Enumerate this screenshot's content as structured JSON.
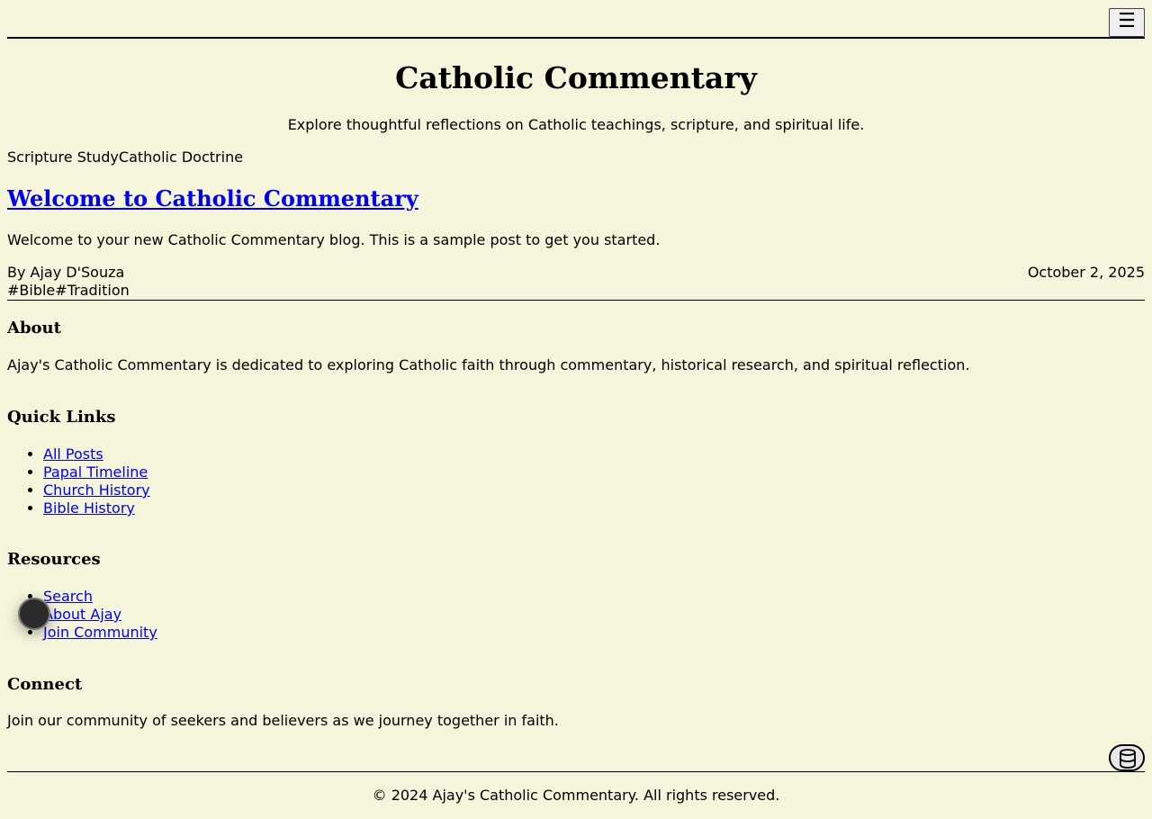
{
  "header": {
    "menu_icon": "☰",
    "site_title": "Catholic Commentary",
    "tagline": "Explore thoughtful reflections on Catholic teachings, scripture, and spiritual life."
  },
  "categories": [
    "Scripture Study",
    "Catholic Doctrine"
  ],
  "post": {
    "title": "Welcome to Catholic Commentary",
    "excerpt": "Welcome to your new Catholic Commentary blog. This is a sample post to get you started.",
    "author": "By Ajay D'Souza",
    "date": "October 2, 2025",
    "tags": [
      "#Bible",
      "#Tradition"
    ]
  },
  "footer": {
    "about": {
      "heading": "About",
      "text": "Ajay's Catholic Commentary is dedicated to exploring Catholic faith through commentary, historical research, and spiritual reflection."
    },
    "quick_links": {
      "heading": "Quick Links",
      "items": [
        "All Posts",
        "Papal Timeline",
        "Church History",
        "Bible History"
      ]
    },
    "resources": {
      "heading": "Resources",
      "items": [
        "Search",
        "About Ajay",
        "Join Community"
      ]
    },
    "connect": {
      "heading": "Connect",
      "text": "Join our community of seekers and believers as we journey together in faith."
    },
    "copyright": "© 2024 Ajay's Catholic Commentary. All rights reserved."
  },
  "icons": {
    "menu": "hamburger-menu-icon",
    "floating": "floating-action-icon",
    "database": "database-icon"
  },
  "colors": {
    "background": "#f5f5dc",
    "link": "#0000ee",
    "text": "#000000"
  }
}
